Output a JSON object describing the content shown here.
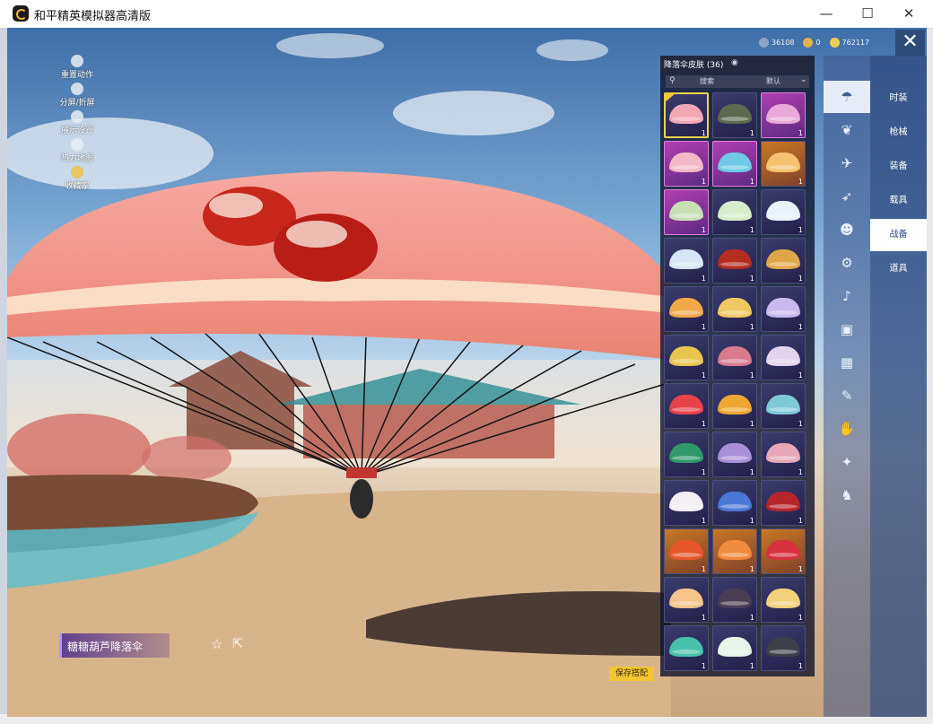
{
  "window": {
    "title": "和平精英模拟器高清版",
    "minimize": "—",
    "maximize": "☐",
    "close": "✕"
  },
  "currency": [
    {
      "icon": "coin-icon",
      "value": "36108",
      "color": "#8fa3c9"
    },
    {
      "icon": "token-icon",
      "value": "0",
      "color": "#e0b44b"
    },
    {
      "icon": "crown-icon",
      "value": "762117",
      "color": "#f2cc52"
    }
  ],
  "game_close": "✕",
  "left_menu": [
    {
      "icon": "avatar-icon",
      "label": "重置动作"
    },
    {
      "icon": "gear-icon",
      "label": "分屏/折屏"
    },
    {
      "icon": "eye-icon",
      "label": "展示设置"
    },
    {
      "icon": "home-icon",
      "label": "热力地图"
    },
    {
      "icon": "badge-icon",
      "label": "收藏家"
    }
  ],
  "panel": {
    "title": "降落伞皮肤 (36)",
    "eye": "◉",
    "search_placeholder": "搜索",
    "sort": "默认"
  },
  "skins": [
    {
      "count": "1",
      "rarity": "blue",
      "color": "#f2a7b3",
      "selected": true
    },
    {
      "count": "1",
      "rarity": "blue",
      "color": "#5e6a4e"
    },
    {
      "count": "1",
      "rarity": "pink",
      "color": "#e9a8d7"
    },
    {
      "count": "1",
      "rarity": "pink",
      "color": "#f5b8c8"
    },
    {
      "count": "1",
      "rarity": "pink",
      "color": "#6ec8e6"
    },
    {
      "count": "1",
      "rarity": "gold",
      "color": "#f6c16f"
    },
    {
      "count": "1",
      "rarity": "pink",
      "color": "#c9e0b6"
    },
    {
      "count": "1",
      "rarity": "blue",
      "color": "#d7ecc9"
    },
    {
      "count": "1",
      "rarity": "blue",
      "color": "#e9f3fb"
    },
    {
      "count": "1",
      "rarity": "blue",
      "color": "#d6e6f8"
    },
    {
      "count": "1",
      "rarity": "blue",
      "color": "#b52d21"
    },
    {
      "count": "1",
      "rarity": "blue",
      "color": "#e0a74a"
    },
    {
      "count": "1",
      "rarity": "blue",
      "color": "#f3a94a"
    },
    {
      "count": "1",
      "rarity": "blue",
      "color": "#f0c860"
    },
    {
      "count": "1",
      "rarity": "blue",
      "color": "#c9b9f0"
    },
    {
      "count": "1",
      "rarity": "blue",
      "color": "#e8c64e"
    },
    {
      "count": "1",
      "rarity": "blue",
      "color": "#d97a8f"
    },
    {
      "count": "1",
      "rarity": "blue",
      "color": "#e4d3ec"
    },
    {
      "count": "1",
      "rarity": "blue",
      "color": "#e8434a"
    },
    {
      "count": "1",
      "rarity": "blue",
      "color": "#f0a632"
    },
    {
      "count": "1",
      "rarity": "blue",
      "color": "#7ec9d8"
    },
    {
      "count": "1",
      "rarity": "blue",
      "color": "#2f9a6c"
    },
    {
      "count": "1",
      "rarity": "blue",
      "color": "#a98fd8"
    },
    {
      "count": "1",
      "rarity": "blue",
      "color": "#e8a7b8"
    },
    {
      "count": "1",
      "rarity": "blue",
      "color": "#f3eef3"
    },
    {
      "count": "1",
      "rarity": "blue",
      "color": "#4a78d6"
    },
    {
      "count": "1",
      "rarity": "blue",
      "color": "#b5252b"
    },
    {
      "count": "1",
      "rarity": "gold",
      "color": "#e9562e"
    },
    {
      "count": "1",
      "rarity": "gold",
      "color": "#f08a3d"
    },
    {
      "count": "1",
      "rarity": "gold",
      "color": "#d9303d"
    },
    {
      "count": "1",
      "rarity": "blue",
      "color": "#f4c48b"
    },
    {
      "count": "1",
      "rarity": "blue",
      "color": "#4a3e54"
    },
    {
      "count": "1",
      "rarity": "blue",
      "color": "#f3d07a"
    },
    {
      "count": "1",
      "rarity": "blue",
      "color": "#49c0a9"
    },
    {
      "count": "1",
      "rarity": "blue",
      "color": "#e6f4ea"
    },
    {
      "count": "1",
      "rarity": "blue",
      "color": "#3f3f4a"
    }
  ],
  "categories": [
    {
      "icon": "parachute-icon",
      "glyph": "☂",
      "active": true
    },
    {
      "icon": "wings-icon",
      "glyph": "❦"
    },
    {
      "icon": "aircraft-icon",
      "glyph": "✈"
    },
    {
      "icon": "plane-icon",
      "glyph": "➶"
    },
    {
      "icon": "smiley-icon",
      "glyph": "☻"
    },
    {
      "icon": "robot-icon",
      "glyph": "⚙"
    },
    {
      "icon": "sound-icon",
      "glyph": "♪"
    },
    {
      "icon": "sticker-icon",
      "glyph": "▣"
    },
    {
      "icon": "picture-icon",
      "glyph": "▦"
    },
    {
      "icon": "spray-icon",
      "glyph": "✎"
    },
    {
      "icon": "gesture-icon",
      "glyph": "✋"
    },
    {
      "icon": "magic-icon",
      "glyph": "✦"
    },
    {
      "icon": "pet-icon",
      "glyph": "♞"
    }
  ],
  "tabs": [
    {
      "label": "时装"
    },
    {
      "label": "枪械"
    },
    {
      "label": "装备"
    },
    {
      "label": "载具"
    },
    {
      "label": "战备",
      "active": true
    },
    {
      "label": "道具"
    }
  ],
  "item_name": "糖糖葫芦降落伞",
  "favorite": "☆",
  "share": "⇱",
  "save_button": "保存搭配"
}
